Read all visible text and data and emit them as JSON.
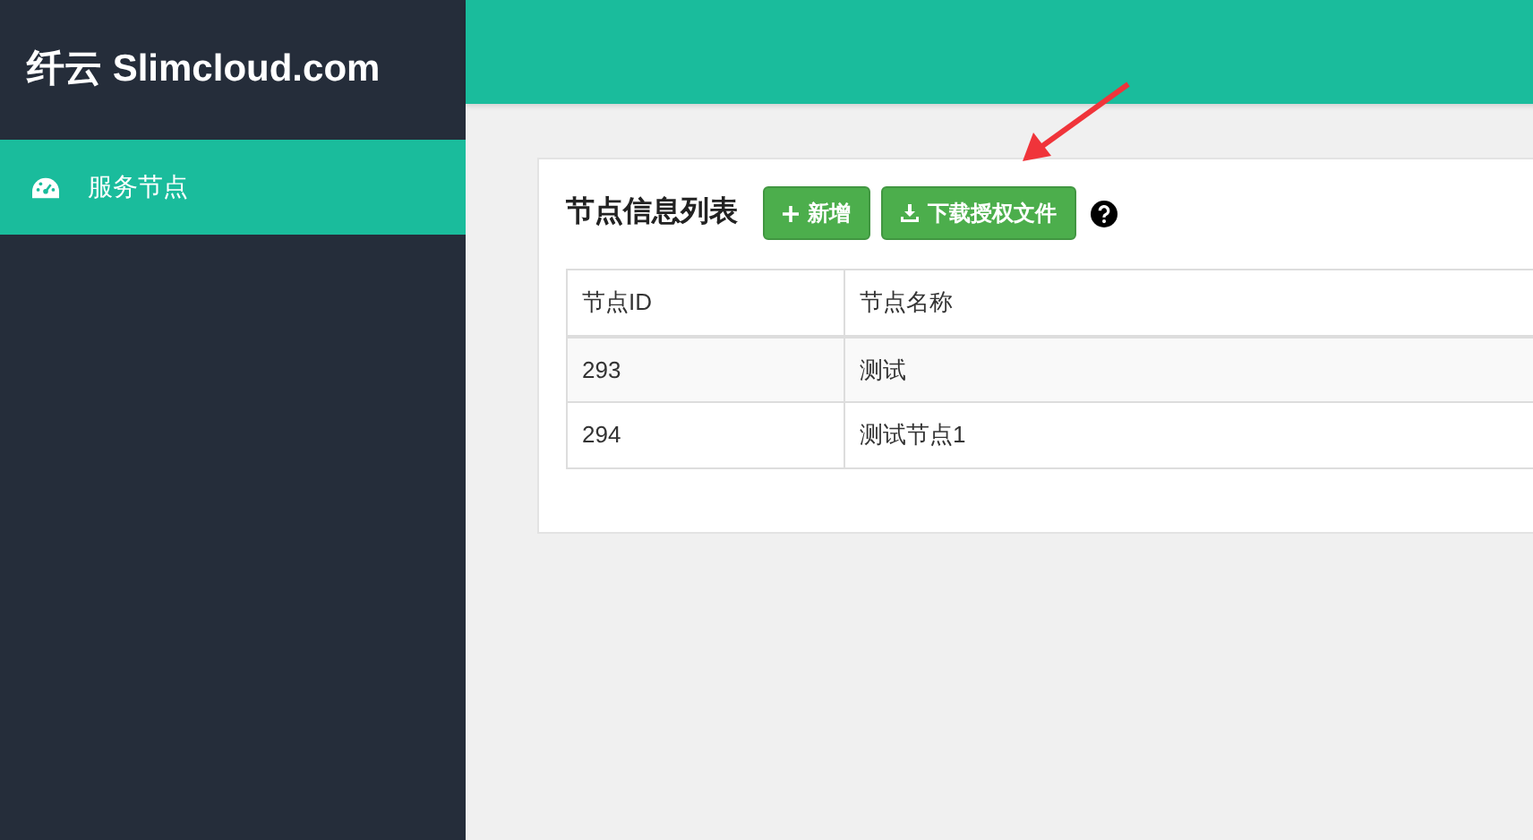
{
  "brand": "纤云 Slimcloud.com",
  "sidebar": {
    "items": [
      {
        "label": "服务节点",
        "selected": true
      }
    ]
  },
  "panel": {
    "title": "节点信息列表",
    "buttons": [
      {
        "label": "新增",
        "kind": "add"
      },
      {
        "label": "下载授权文件",
        "kind": "download"
      }
    ]
  },
  "table": {
    "columns": [
      "节点ID",
      "节点名称"
    ],
    "rows": [
      [
        "293",
        "测试"
      ],
      [
        "294",
        "测试节点1"
      ]
    ]
  }
}
